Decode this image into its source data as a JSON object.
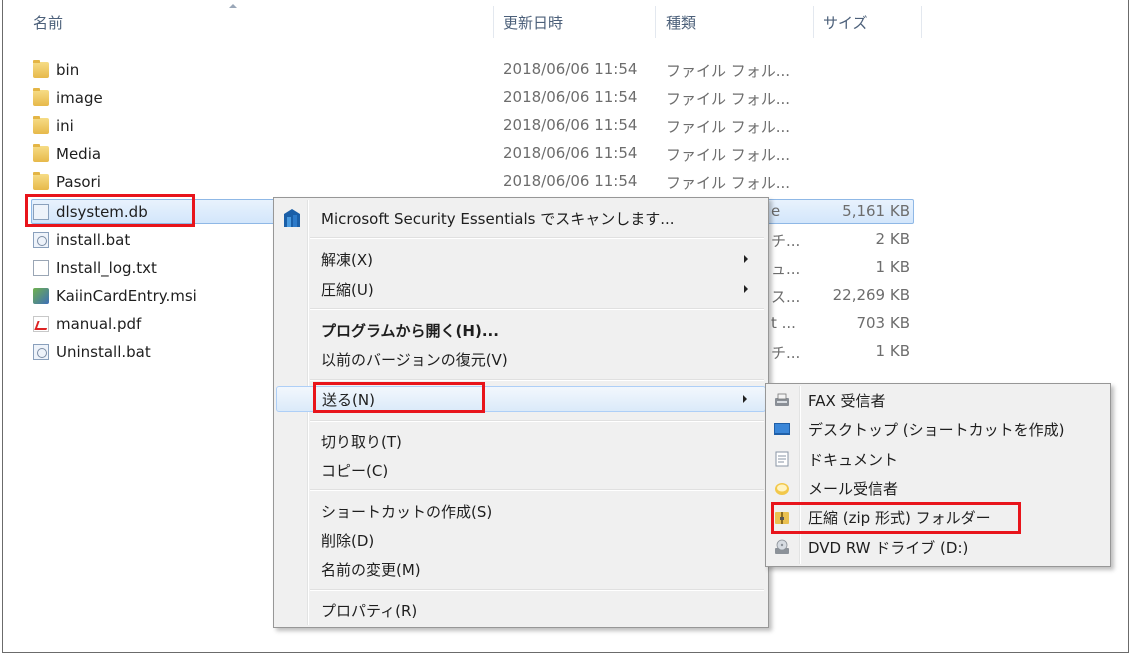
{
  "columns": {
    "name": "名前",
    "modified": "更新日時",
    "type": "種類",
    "size": "サイズ"
  },
  "files": [
    {
      "name": "bin",
      "icon": "folder-icon",
      "date": "2018/06/06 11:54",
      "type": "ファイル フォル...",
      "size": ""
    },
    {
      "name": "image",
      "icon": "folder-icon",
      "date": "2018/06/06 11:54",
      "type": "ファイル フォル...",
      "size": ""
    },
    {
      "name": "ini",
      "icon": "folder-icon",
      "date": "2018/06/06 11:54",
      "type": "ファイル フォル...",
      "size": ""
    },
    {
      "name": "Media",
      "icon": "folder-icon",
      "date": "2018/06/06 11:54",
      "type": "ファイル フォル...",
      "size": ""
    },
    {
      "name": "Pasori",
      "icon": "folder-icon",
      "date": "2018/06/06 11:54",
      "type": "ファイル フォル...",
      "size": ""
    },
    {
      "name": "dlsystem.db",
      "icon": "database-file-icon",
      "type_partial": "e",
      "size": "5,161 KB"
    },
    {
      "name": "install.bat",
      "icon": "batch-file-icon",
      "type_partial": "チ...",
      "size": "2 KB"
    },
    {
      "name": "Install_log.txt",
      "icon": "text-file-icon",
      "type_partial": "ュ...",
      "size": "1 KB"
    },
    {
      "name": "KaiinCardEntry.msi",
      "icon": "installer-icon",
      "type_partial": "ス...",
      "size": "22,269 KB"
    },
    {
      "name": "manual.pdf",
      "icon": "pdf-file-icon",
      "type_partial": "t ...",
      "size": "703 KB"
    },
    {
      "name": "Uninstall.bat",
      "icon": "batch-file-icon",
      "type_partial": "チ...",
      "size": "1 KB"
    }
  ],
  "context_menu": {
    "scan": "Microsoft Security Essentials でスキャンします...",
    "extract": "解凍(X)",
    "compress": "圧縮(U)",
    "open_with": "プログラムから開く(H)...",
    "restore_versions": "以前のバージョンの復元(V)",
    "send_to": "送る(N)",
    "cut": "切り取り(T)",
    "copy": "コピー(C)",
    "create_shortcut": "ショートカットの作成(S)",
    "delete": "削除(D)",
    "rename": "名前の変更(M)",
    "properties": "プロパティ(R)"
  },
  "send_to_menu": [
    {
      "label": "FAX 受信者",
      "icon": "fax-icon"
    },
    {
      "label": "デスクトップ (ショートカットを作成)",
      "icon": "desktop-icon"
    },
    {
      "label": "ドキュメント",
      "icon": "documents-icon"
    },
    {
      "label": "メール受信者",
      "icon": "mail-icon"
    },
    {
      "label": "圧縮 (zip 形式) フォルダー",
      "icon": "zip-folder-icon"
    },
    {
      "label": "DVD RW ドライブ (D:)",
      "icon": "dvd-drive-icon"
    }
  ],
  "highlight_color": "#e8141b"
}
